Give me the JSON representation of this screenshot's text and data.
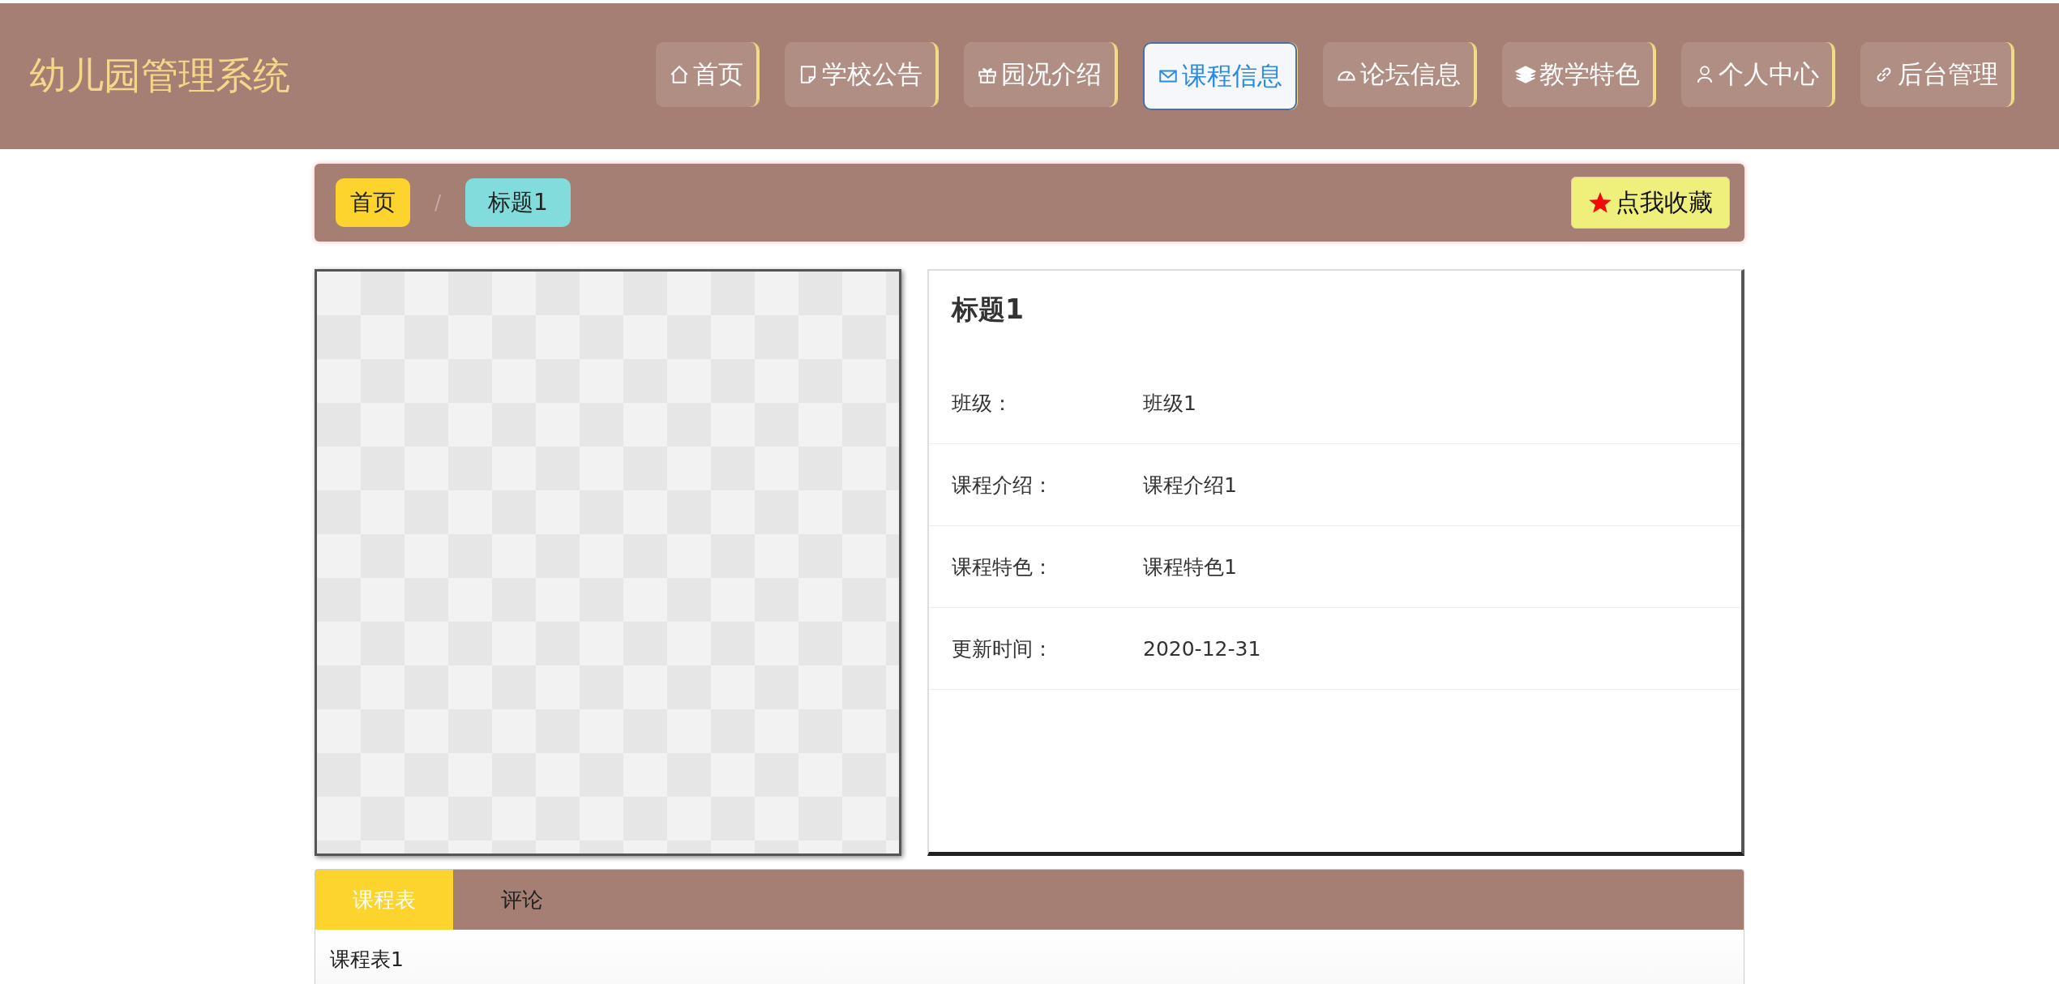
{
  "header": {
    "title": "幼儿园管理系统"
  },
  "nav": [
    {
      "label": "首页",
      "selected": false
    },
    {
      "label": "学校公告",
      "selected": false
    },
    {
      "label": "园况介绍",
      "selected": false
    },
    {
      "label": "课程信息",
      "selected": true
    },
    {
      "label": "论坛信息",
      "selected": false
    },
    {
      "label": "教学特色",
      "selected": false
    },
    {
      "label": "个人中心",
      "selected": false
    },
    {
      "label": "后台管理",
      "selected": false
    }
  ],
  "breadcrumb": {
    "items": [
      {
        "label": "首页",
        "kind": "home"
      },
      {
        "label": "标题1",
        "kind": "current"
      }
    ],
    "separator": "/"
  },
  "favorite_button": {
    "label": "点我收藏"
  },
  "detail": {
    "title": "标题1",
    "fields": [
      {
        "label": "班级：",
        "value": "班级1"
      },
      {
        "label": "课程介绍：",
        "value": "课程介绍1"
      },
      {
        "label": "课程特色：",
        "value": "课程特色1"
      },
      {
        "label": "更新时间：",
        "value": "2020-12-31"
      }
    ]
  },
  "tabs": [
    {
      "label": "课程表",
      "selected": true
    },
    {
      "label": "评论",
      "selected": false
    }
  ],
  "tab_content": "课程表1"
}
